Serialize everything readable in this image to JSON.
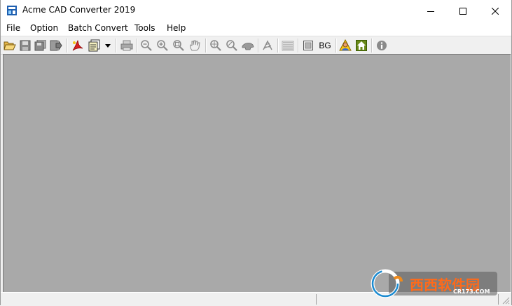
{
  "window": {
    "title": "Acme CAD Converter 2019",
    "controls": [
      "minimize",
      "maximize",
      "close"
    ]
  },
  "menu": {
    "items": [
      "File",
      "Option",
      "Batch Convert",
      "Tools",
      "Help"
    ]
  },
  "toolbar": {
    "bg_label": "BG",
    "icons": [
      "open-folder-icon",
      "save-icon",
      "save-all-icon",
      "export-icon",
      "convert-pdf-icon",
      "batch-icon",
      "dropdown-arrow-icon",
      "print-icon",
      "zoom-out-icon",
      "zoom-in-icon",
      "zoom-window-icon",
      "pan-icon",
      "zoom-extents-icon",
      "zoom-realtime-icon",
      "view-icon",
      "layers-icon",
      "text-icon",
      "frame-icon",
      "background-icon",
      "user-icon",
      "home-icon",
      "info-icon"
    ]
  },
  "colors": {
    "workspace": "#a9a9a9",
    "titlebar": "#ffffff",
    "toolbar": "#f0f0f0"
  },
  "watermark": {
    "cn_text": "西西软件园",
    "site": "CR173.COM"
  }
}
